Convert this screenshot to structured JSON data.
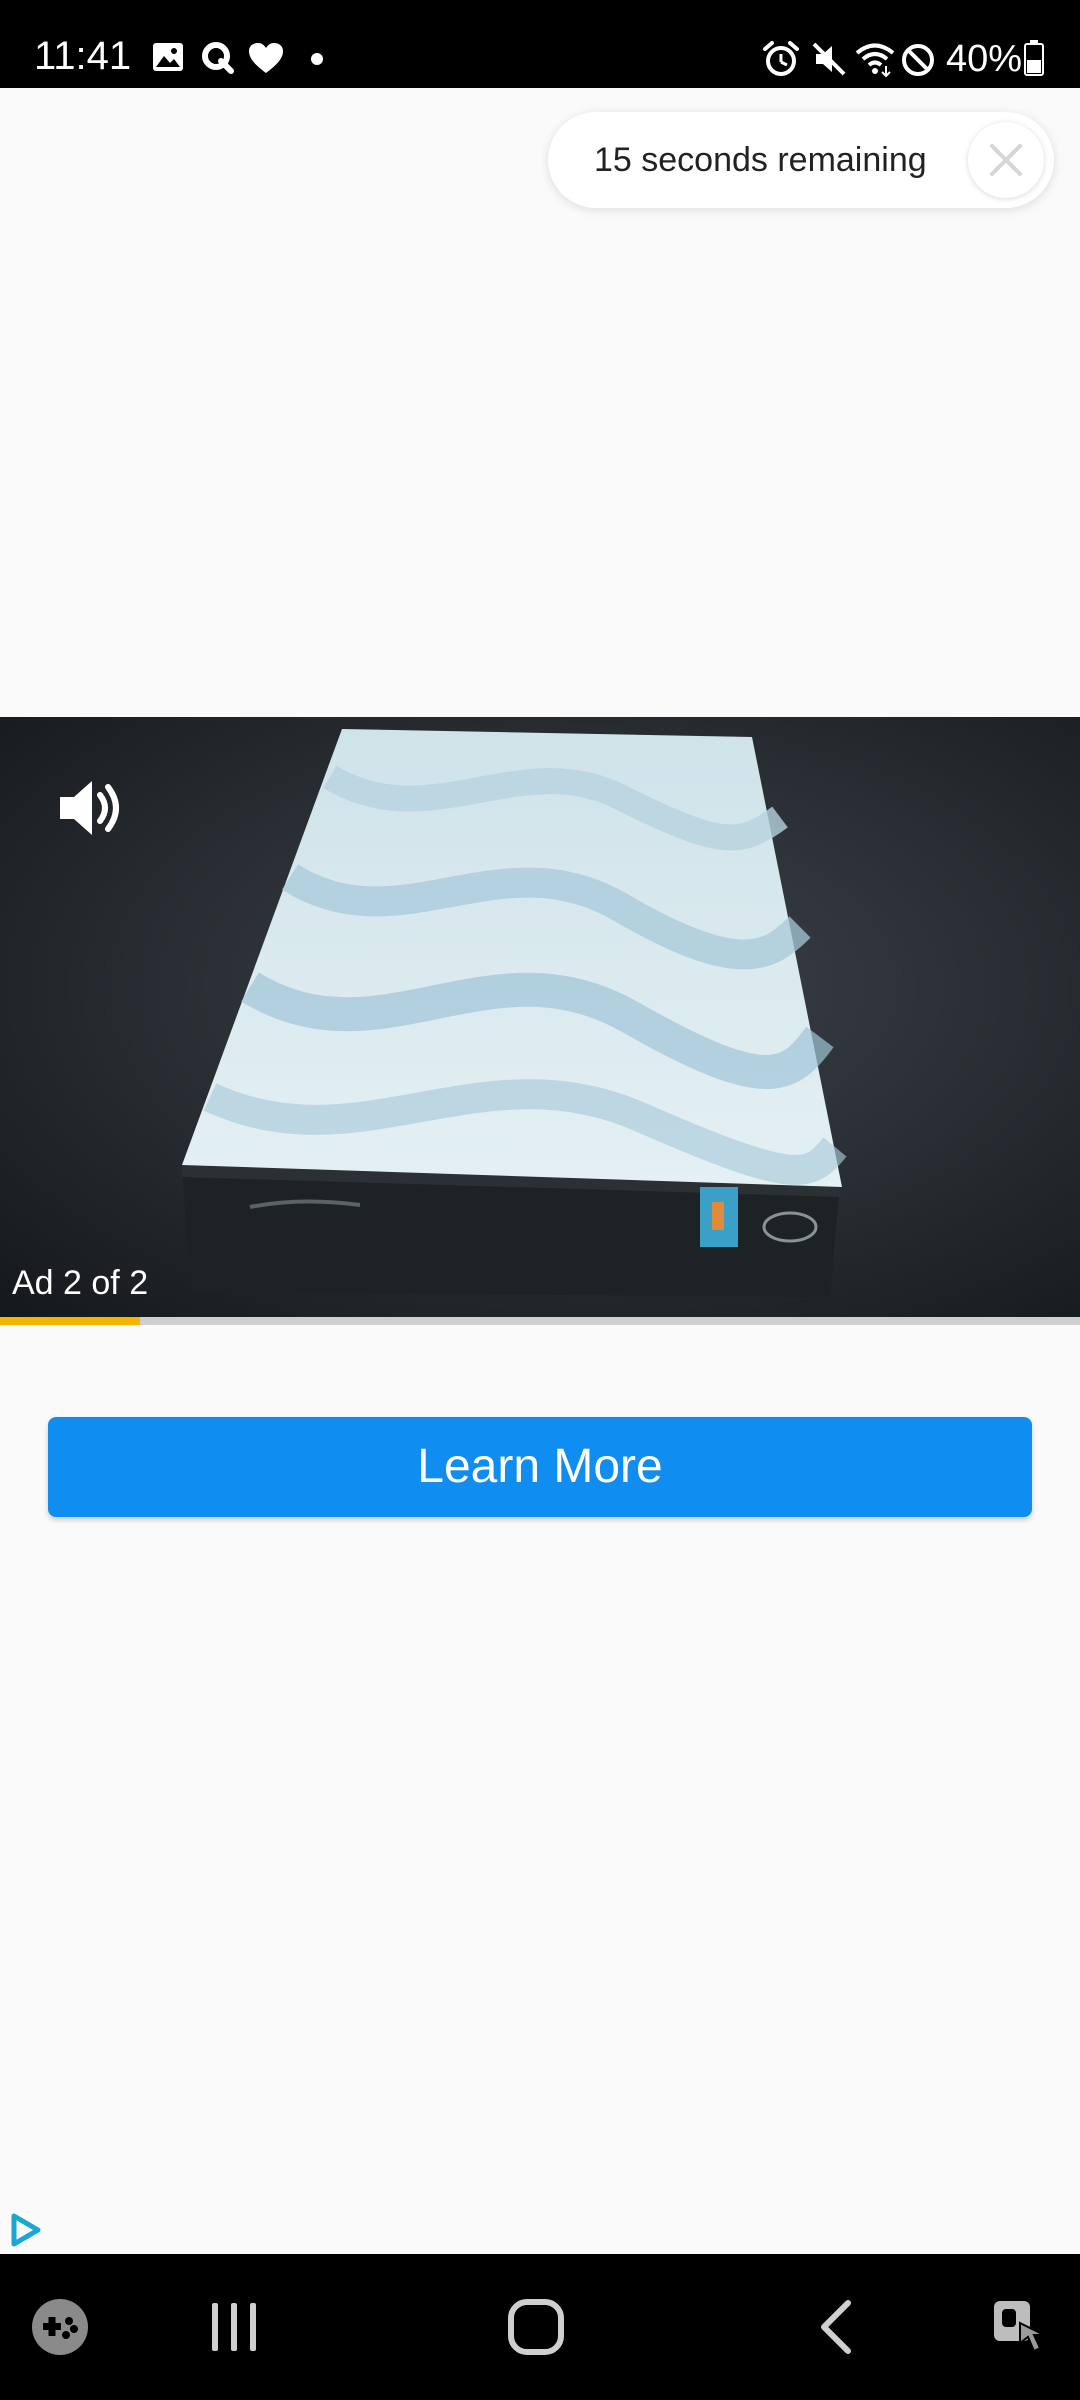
{
  "status_bar": {
    "time": "11:41",
    "battery_text": "40%",
    "icons": [
      "gallery-icon",
      "q-app-icon",
      "heart-icon",
      "dot-icon",
      "alarm-icon",
      "mute-icon",
      "wifi-icon",
      "do-not-disturb-icon",
      "battery-icon"
    ]
  },
  "countdown": {
    "text": "15 seconds remaining",
    "close_icon": "close-icon"
  },
  "video": {
    "ad_counter": "Ad 2 of 2",
    "sound_icon": "volume-icon",
    "progress": 0.13
  },
  "cta": {
    "label": "Learn More",
    "color": "#0f8df0"
  },
  "ad_choices_icon": "adchoices-icon",
  "nav_bar": {
    "items": [
      "game-launcher-icon",
      "recent-apps-icon",
      "home-icon",
      "back-icon",
      "accessibility-icon"
    ]
  }
}
